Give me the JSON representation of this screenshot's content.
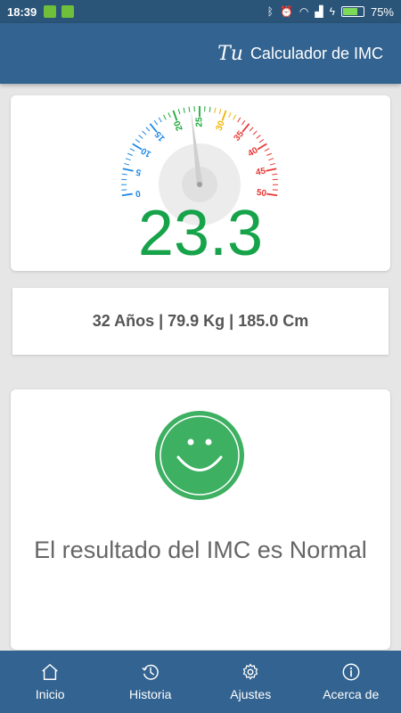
{
  "status_bar": {
    "time": "18:39",
    "battery": "75%",
    "battery_level": 0.75
  },
  "app_bar": {
    "logo": "Tu",
    "title": "Calculador de IMC"
  },
  "gauge": {
    "ticks": [
      "0",
      "5",
      "10",
      "15",
      "20",
      "25",
      "30",
      "35",
      "40",
      "45",
      "50"
    ],
    "tick_colors": [
      "#1e88e5",
      "#1e88e5",
      "#1e88e5",
      "#1e88e5",
      "#1ea83c",
      "#1ea83c",
      "#f0b400",
      "#e53935",
      "#e53935",
      "#e53935",
      "#e53935"
    ],
    "min": 0,
    "max": 50,
    "value": 23.3,
    "value_text": "23.3",
    "value_color": "#16a34a"
  },
  "info": {
    "text": "32 Años | 79.9 Kg | 185.0 Cm"
  },
  "result": {
    "icon": "smiley-face-icon",
    "icon_color": "#3eb062",
    "text": "El resultado del IMC es Normal"
  },
  "nav": {
    "items": [
      {
        "label": "Inicio",
        "icon": "home-icon"
      },
      {
        "label": "Historia",
        "icon": "history-icon"
      },
      {
        "label": "Ajustes",
        "icon": "gear-icon"
      },
      {
        "label": "Acerca de",
        "icon": "info-icon"
      }
    ]
  }
}
